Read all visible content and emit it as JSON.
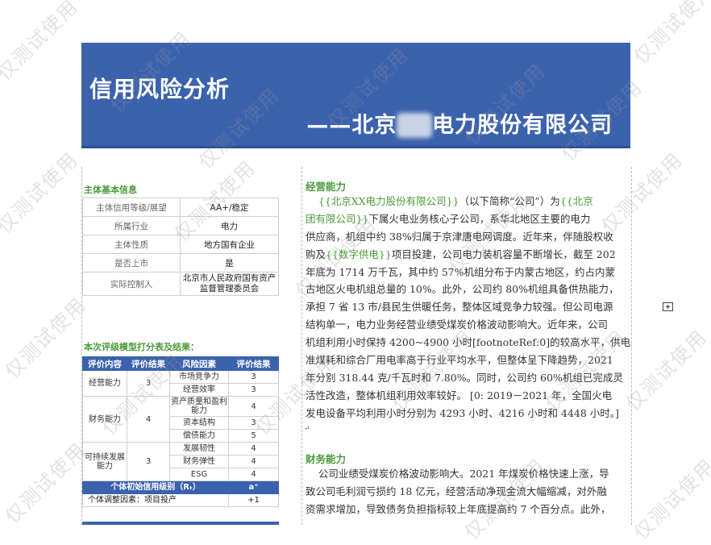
{
  "banner": {
    "title": "信用风险分析",
    "subtitle_prefix": "——北京",
    "subtitle_blur": "XX",
    "subtitle_suffix": "电力股份有限公司"
  },
  "basic_info": {
    "heading": "主体基本信息",
    "rows": [
      {
        "key": "主体信用等级/展望",
        "value": "AA+/稳定"
      },
      {
        "key": "所属行业",
        "value": "电力"
      },
      {
        "key": "主体性质",
        "value": "地方国有企业"
      },
      {
        "key": "是否上市",
        "value": "是"
      },
      {
        "key": "实际控制人",
        "value": "北京市人民政府国有资产监督管理委员会"
      }
    ]
  },
  "score_table": {
    "heading": "本次评级模型打分表及结果：",
    "headers": [
      "评价内容",
      "评价结果",
      "风险因素",
      "评价结果"
    ],
    "groups": [
      {
        "name": "经营能力",
        "score": "3",
        "factors": [
          {
            "name": "市场竞争力",
            "score": "3"
          },
          {
            "name": "经营效率",
            "score": "3"
          }
        ]
      },
      {
        "name": "财务能力",
        "score": "4",
        "factors": [
          {
            "name": "资产质量和盈利能力",
            "score": "4"
          },
          {
            "name": "资本结构",
            "score": "3"
          },
          {
            "name": "偿债能力",
            "score": "5"
          }
        ]
      },
      {
        "name": "可持续发展能力",
        "score": "3",
        "factors": [
          {
            "name": "发展韧性",
            "score": "4"
          },
          {
            "name": "财务弹性",
            "score": "4"
          },
          {
            "name": "ESG",
            "score": "4"
          }
        ]
      }
    ],
    "initial_label": "个体初始信用级别（Rₜ）",
    "initial_value": "a⁺",
    "adjust_label": "个体调整因素：项目投产",
    "adjust_value": "+1"
  },
  "operations": {
    "heading": "经营能力",
    "lines": [
      {
        "pre": "    ",
        "green1": "{{北京XX电力股份有限公司}}",
        "mid": "（以下简称“公司”）为",
        "green2": "{{北京"
      },
      {
        "green1": "团有限公司}}",
        "mid": "下属火电业务核心子公司，系华北地区主要的电力"
      },
      {
        "mid": "供应商，机组中约 38%归属于京津唐电网调度。近年来，伴随股权收"
      },
      {
        "mid": "购及",
        "green1": "{{数字供电}}",
        "mid2": "项目投建，公司电力装机容量不断增长，截至 202"
      },
      {
        "mid": "年底为 1714 万千瓦，其中约 57%机组分布于内蒙古地区，约占内蒙"
      },
      {
        "mid": "古地区火电机组总量的 10%。此外，公司约 80%机组具备供热能力，"
      },
      {
        "mid": "承担 7 省 13 市/县民生供暖任务，整体区域竞争力较强。但公司电源"
      },
      {
        "mid": "结构单一，电力业务经营业绩受煤炭价格波动影响大。近年来，公司"
      },
      {
        "mid": "机组利用小时保持 4200~4900 小时[footnoteRef:0]的较高水平，供电标"
      },
      {
        "mid": "准煤耗和综合厂用电率高于行业平均水平，但整体呈下降趋势，2021"
      },
      {
        "mid": "年分别 318.44 克/千瓦时和 7.80%。同时，公司约 60%机组已完成灵"
      },
      {
        "mid": "活性改造，整体机组利用效率较好。 [0:  2019－2021 年，全国火电"
      },
      {
        "mid": "发电设备平均利用小时分别为 4293 小时、4216 小时和 4448 小时。]"
      }
    ]
  },
  "finance": {
    "heading": "财务能力",
    "lines": [
      "    公司业绩受煤炭价格波动影响大。2021 年煤炭价格快速上涨，导",
      "致公司毛利润亏损约 18 亿元，经营活动净现金流大幅缩减，对外融",
      "资需求增加，导致债务负担指标较上年底提高约 7 个百分点。此外，"
    ]
  },
  "watermark": "仅测试使用",
  "icons": {
    "comment": "comment-add-icon"
  },
  "colors": {
    "banner": "#3b62ad",
    "accent_green": "#4a9a3a"
  }
}
